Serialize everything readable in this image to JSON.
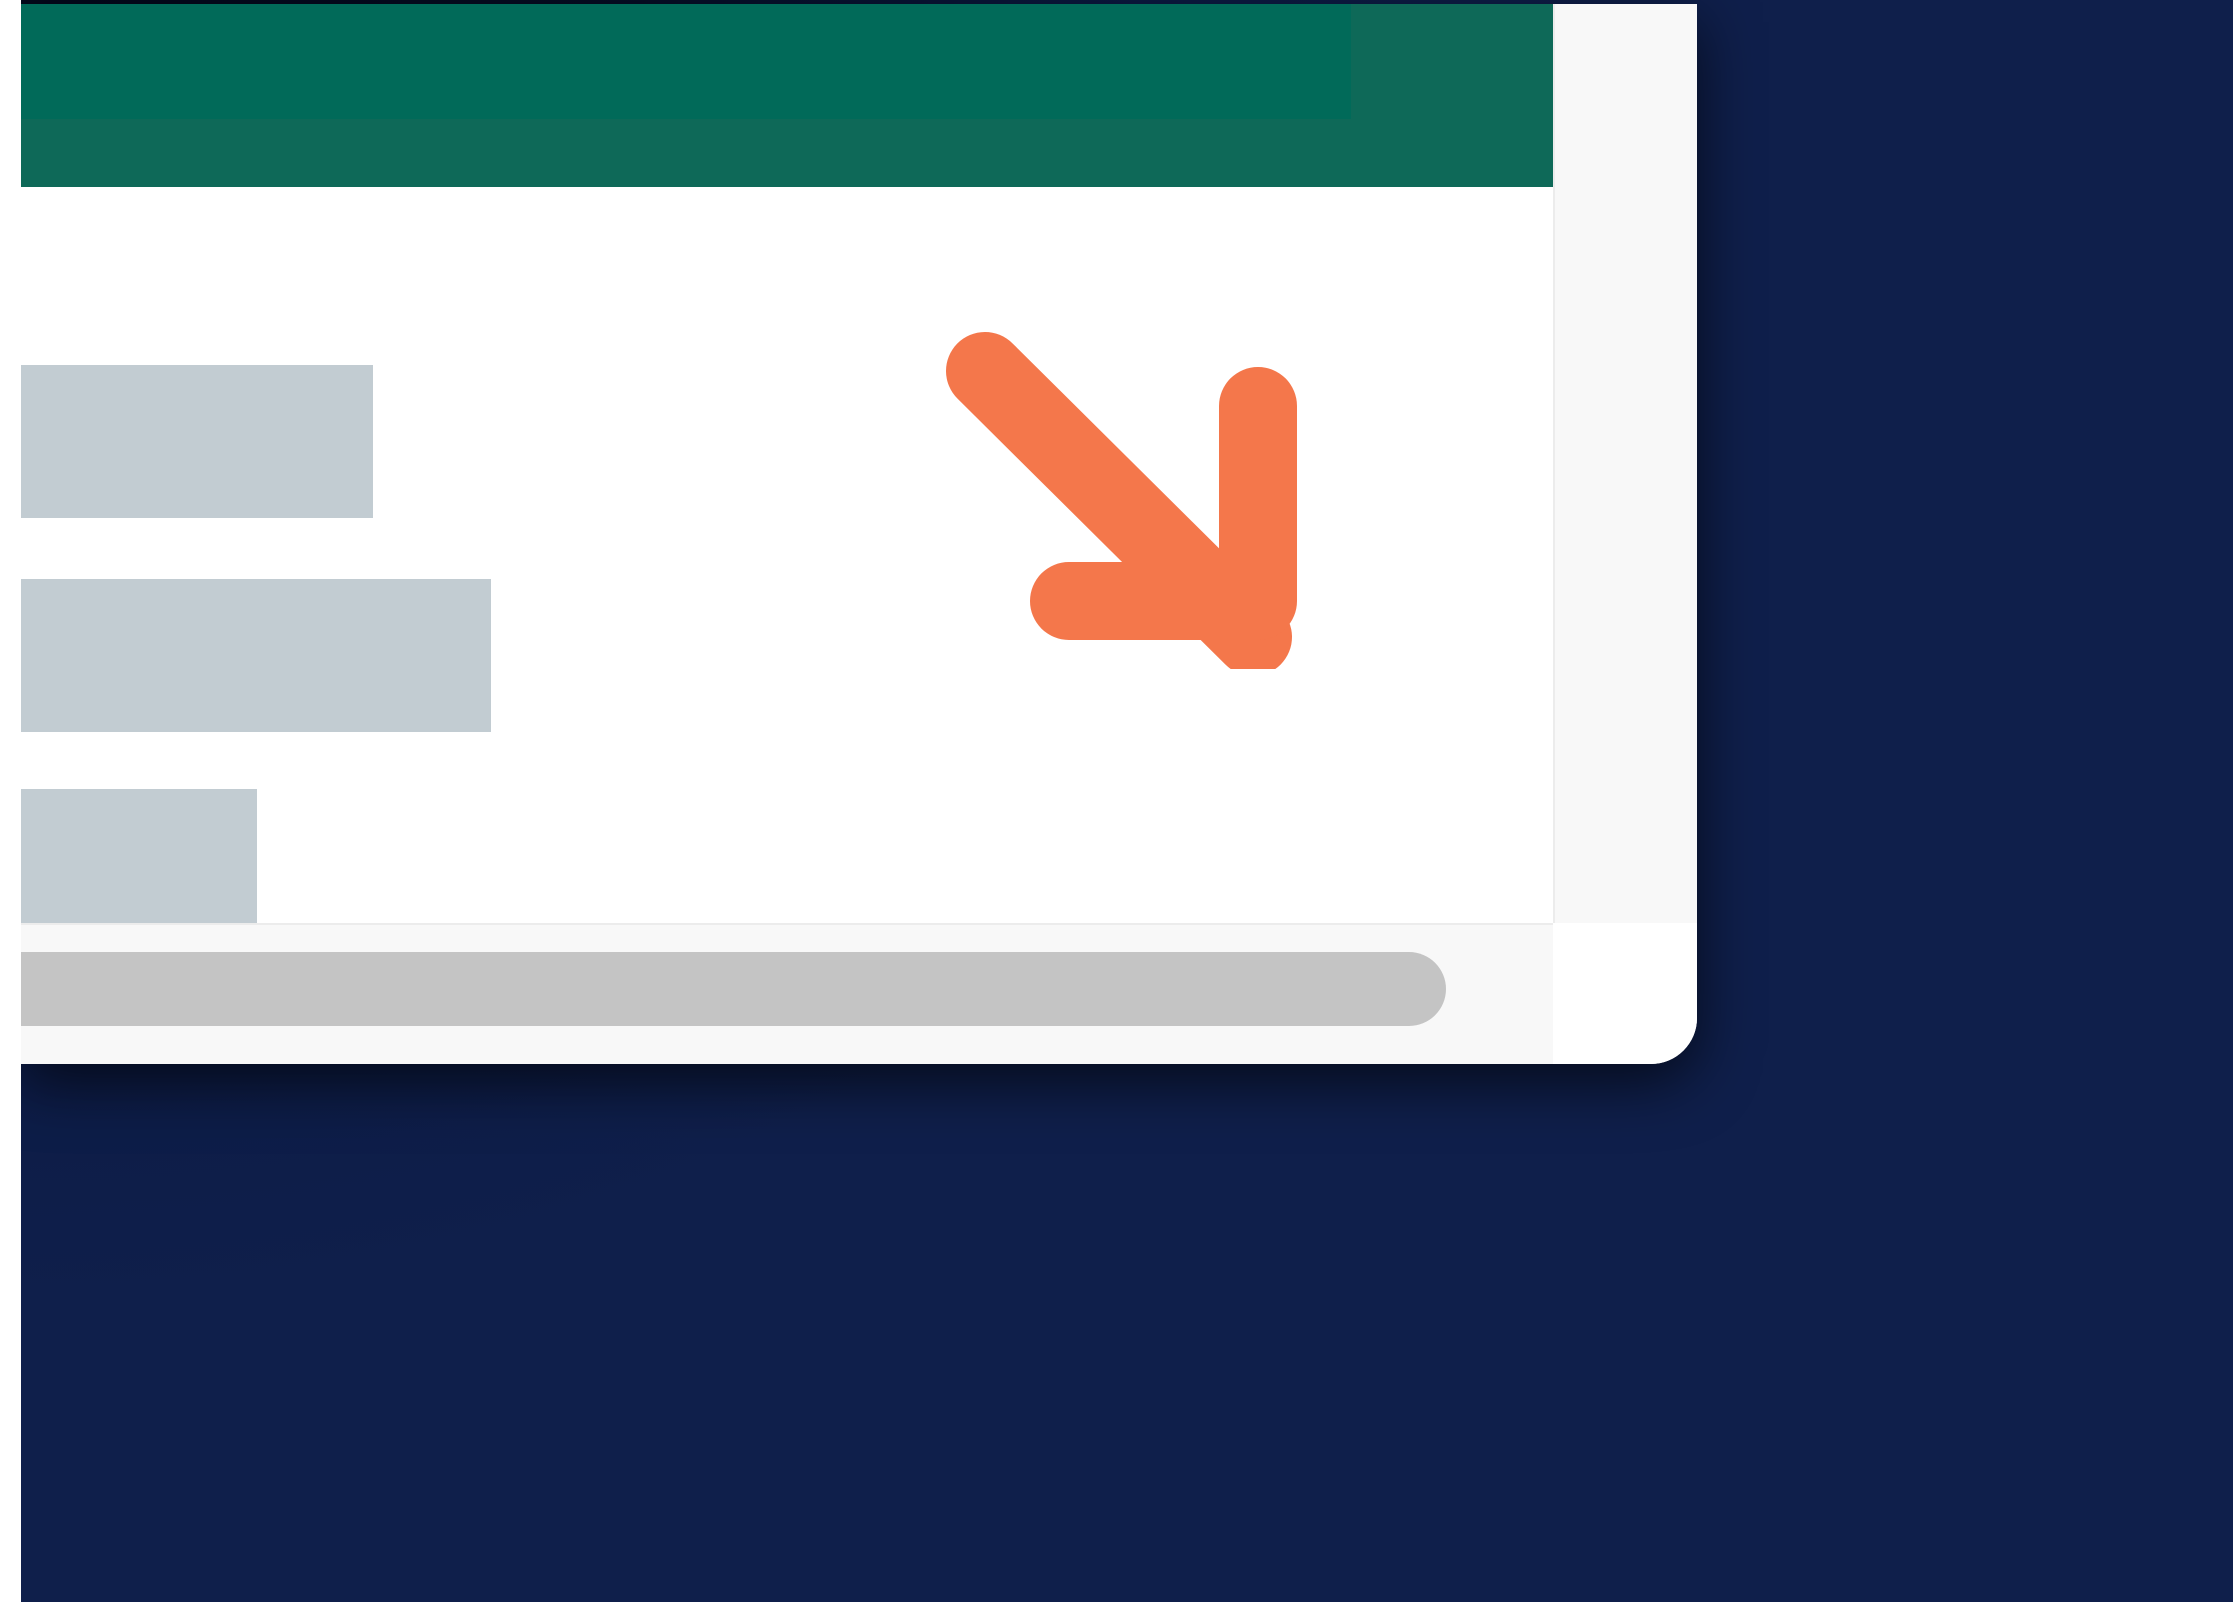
{
  "window": {
    "header_color": "#0e6958",
    "header_inner_color": "#016a59",
    "background": "#ffffff"
  },
  "content": {
    "placeholder_color": "#c2ccd2",
    "placeholder_count": 3
  },
  "resize_arrow": {
    "icon": "arrow-down-right-icon",
    "color": "#f4774b"
  },
  "scrollbars": {
    "track_color": "#f8f8f8",
    "thumb_color": "#c4c4c4"
  },
  "desktop": {
    "background_colors": [
      "#03081c",
      "#0f1f4b"
    ]
  }
}
